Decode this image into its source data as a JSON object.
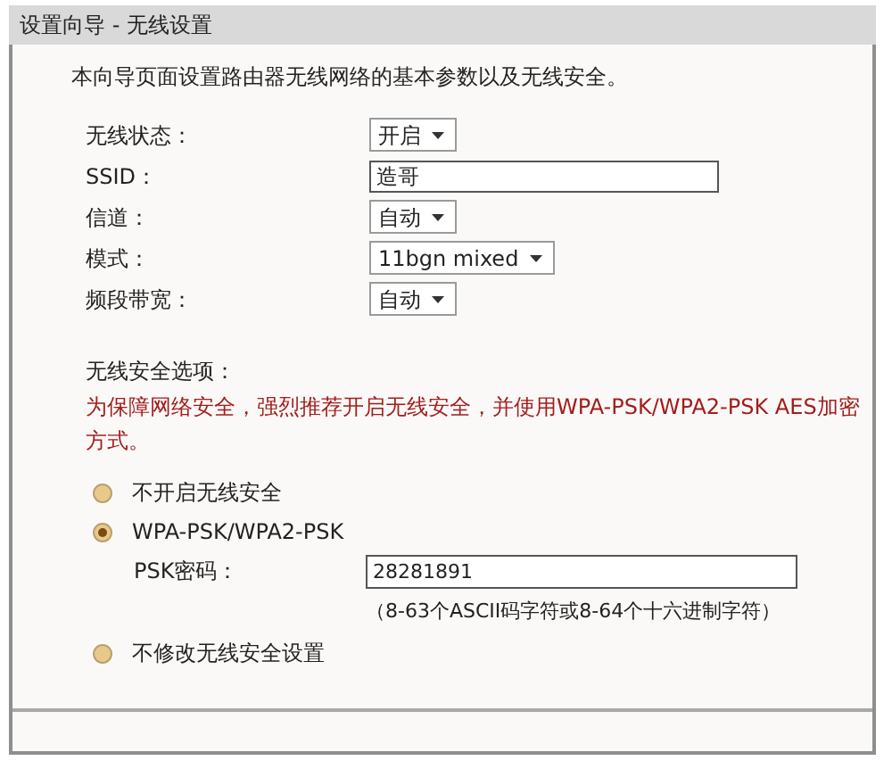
{
  "window": {
    "title": "设置向导 - 无线设置"
  },
  "intro": "本向导页面设置路由器无线网络的基本参数以及无线安全。",
  "fields": [
    {
      "label": "无线状态：",
      "kind": "select",
      "value": "开启"
    },
    {
      "label": "SSID：",
      "kind": "text",
      "value": "造哥"
    },
    {
      "label": "信道：",
      "kind": "select",
      "value": "自动"
    },
    {
      "label": "模式：",
      "kind": "select",
      "value": "11bgn mixed"
    },
    {
      "label": "频段带宽：",
      "kind": "select",
      "value": "自动"
    }
  ],
  "security": {
    "heading": "无线安全选项：",
    "warning": "为保障网络安全，强烈推荐开启无线安全，并使用WPA-PSK/WPA2-PSK AES加密方式。",
    "options": [
      {
        "label": "不开启无线安全",
        "selected": false
      },
      {
        "label": "WPA-PSK/WPA2-PSK",
        "selected": true,
        "password": {
          "label": "PSK密码：",
          "value": "28281891",
          "hint": "（8-63个ASCII码字符或8-64个十六进制字符）"
        }
      },
      {
        "label": "不修改无线安全设置",
        "selected": false
      }
    ]
  }
}
